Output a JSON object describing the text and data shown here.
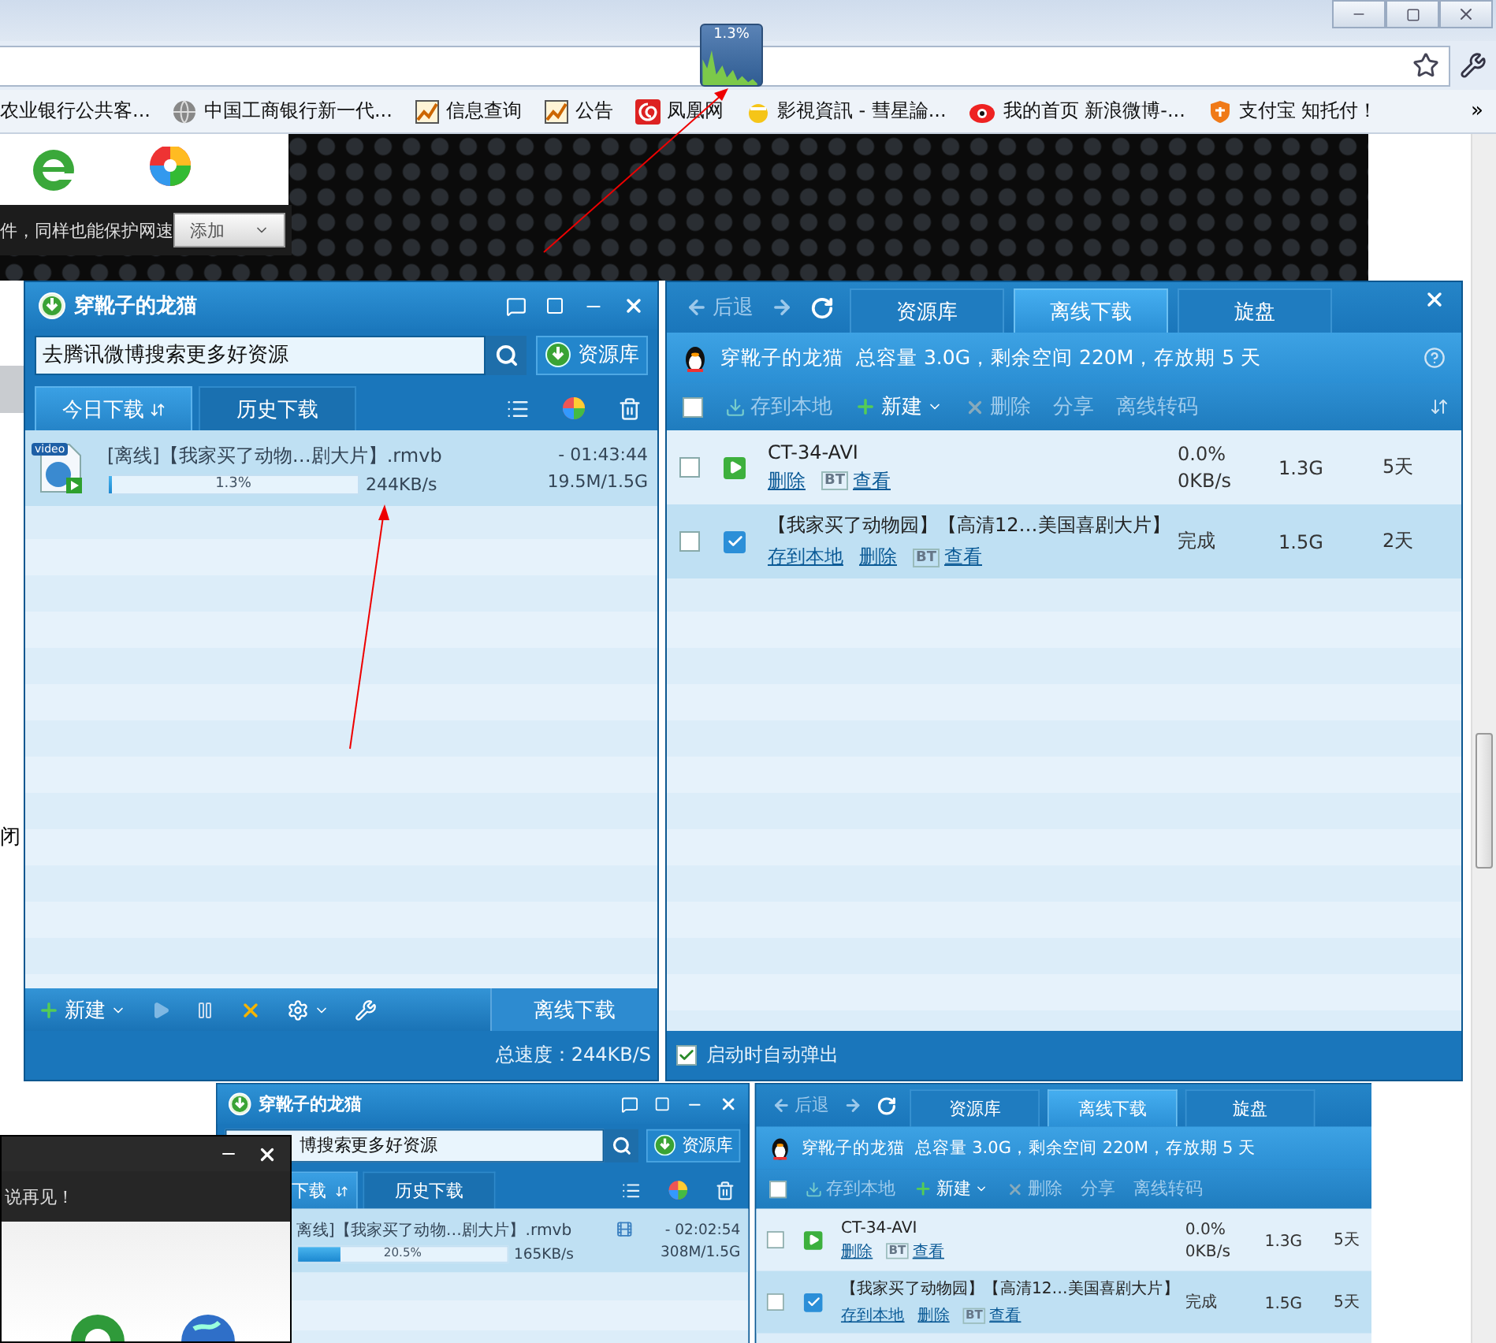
{
  "browser": {
    "speed_widget": {
      "reading": "1.3%"
    },
    "bookmarks": [
      {
        "label": "农业银行公共客..."
      },
      {
        "label": "中国工商银行新一代..."
      },
      {
        "label": "信息查询"
      },
      {
        "label": "公告"
      },
      {
        "label": "凤凰网"
      },
      {
        "label": "影視資訊 - 彗星論..."
      },
      {
        "label": "我的首页 新浪微博-..."
      },
      {
        "label": "支付宝 知托付！"
      }
    ],
    "overflow": "»"
  },
  "page": {
    "popup_text": "件，同样也能保护网速",
    "add_button": "添加",
    "side_text": "闭"
  },
  "windows": [
    {
      "title": "穿靴子的龙猫",
      "search": "去腾讯微博搜索更多好资源",
      "resource_button": "资源库",
      "tabs": [
        {
          "label": "今日下载",
          "selected": true
        },
        {
          "label": "历史下载",
          "selected": false
        }
      ],
      "downloads": [
        {
          "file_badge": "video",
          "name": "[离线]【我家买了动物…剧大片】.rmvb",
          "level": 0.013,
          "percent": "1.3%",
          "speed": "244KB/s",
          "remaining": "- 01:43:44",
          "size": "19.5M/1.5G",
          "preview": false
        }
      ],
      "toolbar": {
        "new": "新建",
        "offline": "离线下载"
      },
      "total_speed": "总速度：244KB/S",
      "offline": {
        "back": "后退",
        "tabs": [
          {
            "label": "资源库",
            "selected": false
          },
          {
            "label": "离线下载",
            "selected": true
          },
          {
            "label": "旋盘",
            "selected": false
          }
        ],
        "user": "穿靴子的龙猫",
        "quota": "总容量 3.0G，剩余空间 220M，存放期 5 天",
        "select_all": false,
        "actions": [
          {
            "kind": "save",
            "label": "存到本地"
          },
          {
            "kind": "new",
            "label": "新建"
          },
          {
            "kind": "delete",
            "label": "删除"
          },
          {
            "kind": "share",
            "label": "分享"
          },
          {
            "kind": "transcode",
            "label": "离线转码"
          }
        ],
        "tasks": [
          {
            "kind": "running",
            "checked": false,
            "selected": false,
            "name": "CT-34-AVI",
            "links": [
              {
                "label": "删除"
              },
              {
                "badge": "BT",
                "label": "查看"
              }
            ],
            "progress": "0.0%",
            "speed": "0KB/s",
            "size": "1.3G",
            "days": "5天"
          },
          {
            "kind": "done",
            "checked": false,
            "selected": true,
            "name": "【我家买了动物园】【高清12…美国喜剧大片】",
            "links": [
              {
                "label": "存到本地"
              },
              {
                "label": "删除"
              },
              {
                "badge": "BT",
                "label": "查看"
              }
            ],
            "status": "完成",
            "size": "1.5G",
            "days": "2天"
          }
        ],
        "auto_popup": {
          "label": "启动时自动弹出",
          "checked": true
        }
      }
    },
    {
      "title": "穿靴子的龙猫",
      "search": "博搜索更多好资源",
      "resource_button": "资源库",
      "tabs": [
        {
          "label": "下载",
          "selected": true
        },
        {
          "label": "历史下载",
          "selected": false
        }
      ],
      "downloads": [
        {
          "name": "离线]【我家买了动物…剧大片】.rmvb",
          "level": 0.205,
          "percent": "20.5%",
          "speed": "165KB/s",
          "remaining": "- 02:02:54",
          "size": "308M/1.5G",
          "preview": true
        }
      ],
      "offline": {
        "back": "后退",
        "tabs": [
          {
            "label": "资源库",
            "selected": false
          },
          {
            "label": "离线下载",
            "selected": true
          },
          {
            "label": "旋盘",
            "selected": false
          }
        ],
        "user": "穿靴子的龙猫",
        "quota": "总容量 3.0G，剩余空间 220M，存放期 5 天",
        "select_all": false,
        "actions": [
          {
            "kind": "save",
            "label": "存到本地"
          },
          {
            "kind": "new",
            "label": "新建"
          },
          {
            "kind": "delete",
            "label": "删除"
          },
          {
            "kind": "share",
            "label": "分享"
          },
          {
            "kind": "transcode",
            "label": "离线转码"
          }
        ],
        "tasks": [
          {
            "kind": "running",
            "checked": false,
            "selected": false,
            "name": "CT-34-AVI",
            "links": [
              {
                "label": "删除"
              },
              {
                "badge": "BT",
                "label": "查看"
              }
            ],
            "progress": "0.0%",
            "speed": "0KB/s",
            "size": "1.3G",
            "days": "5天"
          },
          {
            "kind": "done",
            "checked": false,
            "selected": true,
            "name": "【我家买了动物园】【高清12…美国喜剧大片】",
            "links": [
              {
                "label": "存到本地"
              },
              {
                "label": "删除"
              },
              {
                "badge": "BT",
                "label": "查看"
              }
            ],
            "status": "完成",
            "size": "1.5G",
            "days": "5天"
          }
        ]
      }
    }
  ],
  "dialog": {
    "text": "说再见！"
  }
}
